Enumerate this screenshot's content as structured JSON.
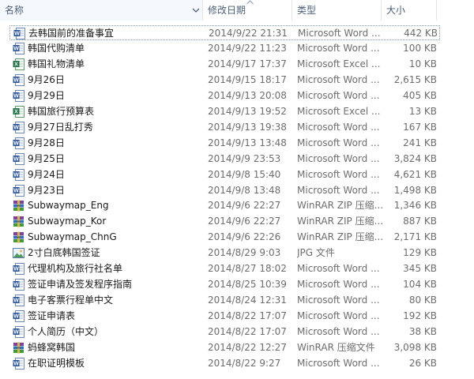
{
  "header": {
    "name": "名称",
    "date": "修改日期",
    "type": "类型",
    "size": "大小"
  },
  "files": [
    {
      "name": "去韩国前的准备事宜",
      "date": "2014/9/22 21:31",
      "type": "Microsoft Word ...",
      "size": "442 KB",
      "icon": "word-icon"
    },
    {
      "name": "韩国代购清单",
      "date": "2014/9/22 11:23",
      "type": "Microsoft Word ...",
      "size": "100 KB",
      "icon": "word-icon"
    },
    {
      "name": "韩国礼物清单",
      "date": "2014/9/17 17:37",
      "type": "Microsoft Excel ...",
      "size": "10 KB",
      "icon": "excel-icon"
    },
    {
      "name": "9月26日",
      "date": "2014/9/15 18:17",
      "type": "Microsoft Word ...",
      "size": "2,615 KB",
      "icon": "word-icon"
    },
    {
      "name": "9月29日",
      "date": "2014/9/13 20:08",
      "type": "Microsoft Word ...",
      "size": "405 KB",
      "icon": "word-icon"
    },
    {
      "name": "韩国旅行预算表",
      "date": "2014/9/13 19:52",
      "type": "Microsoft Excel ...",
      "size": "13 KB",
      "icon": "excel-icon"
    },
    {
      "name": "9月27日乱打秀",
      "date": "2014/9/13 19:38",
      "type": "Microsoft Word ...",
      "size": "167 KB",
      "icon": "word-icon"
    },
    {
      "name": "9月28日",
      "date": "2014/9/13 13:48",
      "type": "Microsoft Word ...",
      "size": "241 KB",
      "icon": "word-icon"
    },
    {
      "name": "9月25日",
      "date": "2014/9/9 23:53",
      "type": "Microsoft Word ...",
      "size": "3,824 KB",
      "icon": "word-icon"
    },
    {
      "name": "9月24日",
      "date": "2014/9/8 15:40",
      "type": "Microsoft Word ...",
      "size": "4,621 KB",
      "icon": "word-icon"
    },
    {
      "name": "9月23日",
      "date": "2014/9/8 13:48",
      "type": "Microsoft Word ...",
      "size": "1,498 KB",
      "icon": "word-icon"
    },
    {
      "name": "Subwaymap_Eng",
      "date": "2014/9/6 22:27",
      "type": "WinRAR ZIP 压缩...",
      "size": "1,346 KB",
      "icon": "winrar-icon"
    },
    {
      "name": "Subwaymap_Kor",
      "date": "2014/9/6 22:27",
      "type": "WinRAR ZIP 压缩...",
      "size": "887 KB",
      "icon": "winrar-icon"
    },
    {
      "name": "Subwaymap_ChnG",
      "date": "2014/9/6 22:26",
      "type": "WinRAR ZIP 压缩...",
      "size": "2,171 KB",
      "icon": "winrar-icon"
    },
    {
      "name": "2寸白底韩国签证",
      "date": "2014/8/29 9:03",
      "type": "JPG 文件",
      "size": "129 KB",
      "icon": "image-icon"
    },
    {
      "name": "代理机构及旅行社名单",
      "date": "2014/8/27 18:02",
      "type": "Microsoft Word ...",
      "size": "345 KB",
      "icon": "word-icon"
    },
    {
      "name": "签证申请及签发程序指南",
      "date": "2014/8/25 10:39",
      "type": "Microsoft Word ...",
      "size": "104 KB",
      "icon": "word-icon"
    },
    {
      "name": "电子客票行程单中文",
      "date": "2014/8/24 12:31",
      "type": "Microsoft Word ...",
      "size": "80 KB",
      "icon": "word-icon"
    },
    {
      "name": "签证申请表",
      "date": "2014/8/22 17:07",
      "type": "Microsoft Word ...",
      "size": "192 KB",
      "icon": "word-icon"
    },
    {
      "name": "个人简历（中文）",
      "date": "2014/8/22 17:07",
      "type": "Microsoft Word ...",
      "size": "38 KB",
      "icon": "word-icon"
    },
    {
      "name": "蚂蜂窝韩国",
      "date": "2014/8/22 12:27",
      "type": "WinRAR 压缩文件",
      "size": "3,098 KB",
      "icon": "winrar-icon"
    },
    {
      "name": "在职证明模板",
      "date": "2014/8/22 9:27",
      "type": "Microsoft Word ...",
      "size": "26 KB",
      "icon": "word-icon"
    }
  ]
}
